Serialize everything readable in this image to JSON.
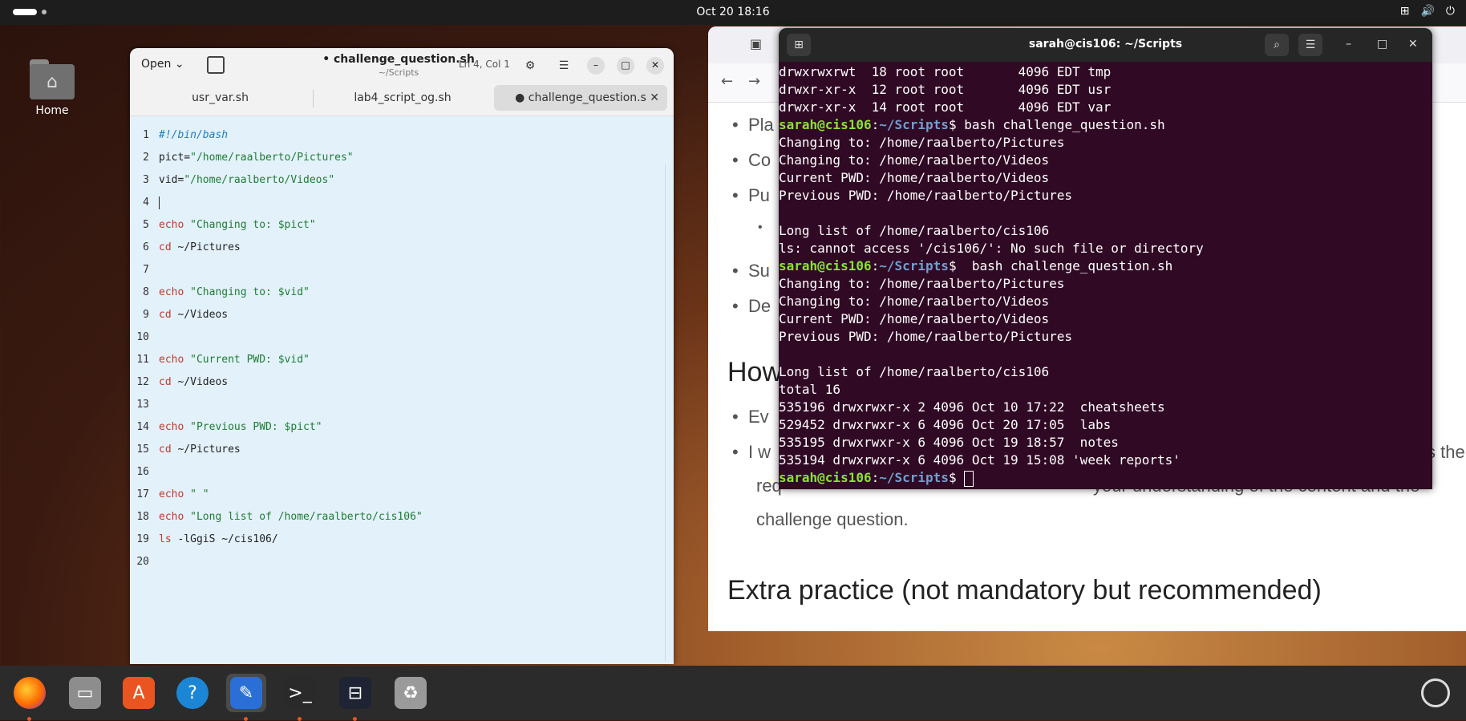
{
  "topbar": {
    "clock": "Oct 20  18:16"
  },
  "desktop": {
    "home_label": "Home"
  },
  "editor": {
    "open_label": "Open",
    "doc_title": "• challenge_question.sh",
    "doc_path": "~/Scripts",
    "cursor_pos": "Ln 4, Col 1",
    "tabs": [
      "usr_var.sh",
      "lab4_script_og.sh",
      "● challenge_question.s"
    ],
    "lines": [
      {
        "n": "1",
        "parts": [
          [
            "cm",
            "#!/bin/bash"
          ]
        ]
      },
      {
        "n": "2",
        "parts": [
          [
            "",
            "pict="
          ],
          [
            "str",
            "\"/home/raalberto/Pictures\""
          ]
        ]
      },
      {
        "n": "3",
        "parts": [
          [
            "",
            "vid="
          ],
          [
            "str",
            "\"/home/raalberto/Videos\""
          ]
        ]
      },
      {
        "n": "4",
        "parts": [
          [
            "",
            "|"
          ]
        ]
      },
      {
        "n": "5",
        "parts": [
          [
            "kw",
            "echo "
          ],
          [
            "str",
            "\"Changing to: $pict\""
          ]
        ]
      },
      {
        "n": "6",
        "parts": [
          [
            "kw",
            "cd "
          ],
          [
            "",
            "~/Pictures"
          ]
        ]
      },
      {
        "n": "7",
        "parts": []
      },
      {
        "n": "8",
        "parts": [
          [
            "kw",
            "echo "
          ],
          [
            "str",
            "\"Changing to: $vid\""
          ]
        ]
      },
      {
        "n": "9",
        "parts": [
          [
            "kw",
            "cd "
          ],
          [
            "",
            "~/Videos"
          ]
        ]
      },
      {
        "n": "10",
        "parts": []
      },
      {
        "n": "11",
        "parts": [
          [
            "kw",
            "echo "
          ],
          [
            "str",
            "\"Current PWD: $vid\""
          ]
        ]
      },
      {
        "n": "12",
        "parts": [
          [
            "kw",
            "cd "
          ],
          [
            "",
            "~/Videos"
          ]
        ]
      },
      {
        "n": "13",
        "parts": []
      },
      {
        "n": "14",
        "parts": [
          [
            "kw",
            "echo "
          ],
          [
            "str",
            "\"Previous PWD: $pict\""
          ]
        ]
      },
      {
        "n": "15",
        "parts": [
          [
            "kw",
            "cd "
          ],
          [
            "",
            "~/Pictures"
          ]
        ]
      },
      {
        "n": "16",
        "parts": []
      },
      {
        "n": "17",
        "parts": [
          [
            "kw",
            "echo "
          ],
          [
            "str",
            "\" \""
          ]
        ]
      },
      {
        "n": "18",
        "parts": [
          [
            "kw",
            "echo "
          ],
          [
            "str",
            "\"Long list of /home/raalberto/cis106\""
          ]
        ]
      },
      {
        "n": "19",
        "parts": [
          [
            "kw",
            "ls "
          ],
          [
            "",
            "-lGgiS ~/cis106/"
          ]
        ]
      },
      {
        "n": "20",
        "parts": []
      }
    ]
  },
  "terminal": {
    "title": "sarah@cis106: ~/Scripts",
    "lines": [
      {
        "t": "out",
        "text": "drwxrwxrwt  18 root root       4096 EDT tmp"
      },
      {
        "t": "out",
        "text": "drwxr-xr-x  12 root root       4096 EDT usr"
      },
      {
        "t": "out",
        "text": "drwxr-xr-x  14 root root       4096 EDT var"
      },
      {
        "t": "prompt",
        "user": "sarah@cis106",
        "path": "~/Scripts",
        "cmd": " bash challenge_question.sh"
      },
      {
        "t": "out",
        "text": "Changing to: /home/raalberto/Pictures"
      },
      {
        "t": "out",
        "text": "Changing to: /home/raalberto/Videos"
      },
      {
        "t": "out",
        "text": "Current PWD: /home/raalberto/Videos"
      },
      {
        "t": "out",
        "text": "Previous PWD: /home/raalberto/Pictures"
      },
      {
        "t": "out",
        "text": " "
      },
      {
        "t": "out",
        "text": "Long list of /home/raalberto/cis106"
      },
      {
        "t": "out",
        "text": "ls: cannot access '/cis106/': No such file or directory"
      },
      {
        "t": "prompt",
        "user": "sarah@cis106",
        "path": "~/Scripts",
        "cmd": "  bash challenge_question.sh"
      },
      {
        "t": "out",
        "text": "Changing to: /home/raalberto/Pictures"
      },
      {
        "t": "out",
        "text": "Changing to: /home/raalberto/Videos"
      },
      {
        "t": "out",
        "text": "Current PWD: /home/raalberto/Videos"
      },
      {
        "t": "out",
        "text": "Previous PWD: /home/raalberto/Pictures"
      },
      {
        "t": "out",
        "text": " "
      },
      {
        "t": "out",
        "text": "Long list of /home/raalberto/cis106"
      },
      {
        "t": "out",
        "text": "total 16"
      },
      {
        "t": "out",
        "text": "535196 drwxrwxr-x 2 4096 Oct 10 17:22  cheatsheets"
      },
      {
        "t": "out",
        "text": "529452 drwxrwxr-x 6 4096 Oct 20 17:05  labs"
      },
      {
        "t": "out",
        "text": "535195 drwxrwxr-x 6 4096 Oct 19 18:57  notes"
      },
      {
        "t": "out",
        "text": "535194 drwxrwxr-x 6 4096 Oct 19 15:08 'week reports'"
      },
      {
        "t": "prompt",
        "user": "sarah@cis106",
        "path": "~/Scripts",
        "cmd": " ",
        "cursor": true
      }
    ]
  },
  "browser": {
    "bullets": [
      "Pla",
      "Co",
      "Pu",
      "Su",
      "De",
      "Ev"
    ],
    "heading1": "How",
    "para_line1": "I w",
    "para_end1": "s the",
    "para_line2": "req",
    "para_line2b": "your understanding of the content and the",
    "para_line3": "challenge question.",
    "heading2": "Extra practice (not mandatory but recommended)"
  },
  "dock": {
    "items": [
      "firefox-icon",
      "files-icon",
      "app-center-icon",
      "help-icon",
      "text-editor-icon",
      "terminal-icon",
      "terminal-split-icon",
      "trash-icon"
    ]
  },
  "colors": {
    "terminal_bg": "#300a24",
    "editor_bg": "#e3f1fb",
    "accent": "#e95420"
  }
}
